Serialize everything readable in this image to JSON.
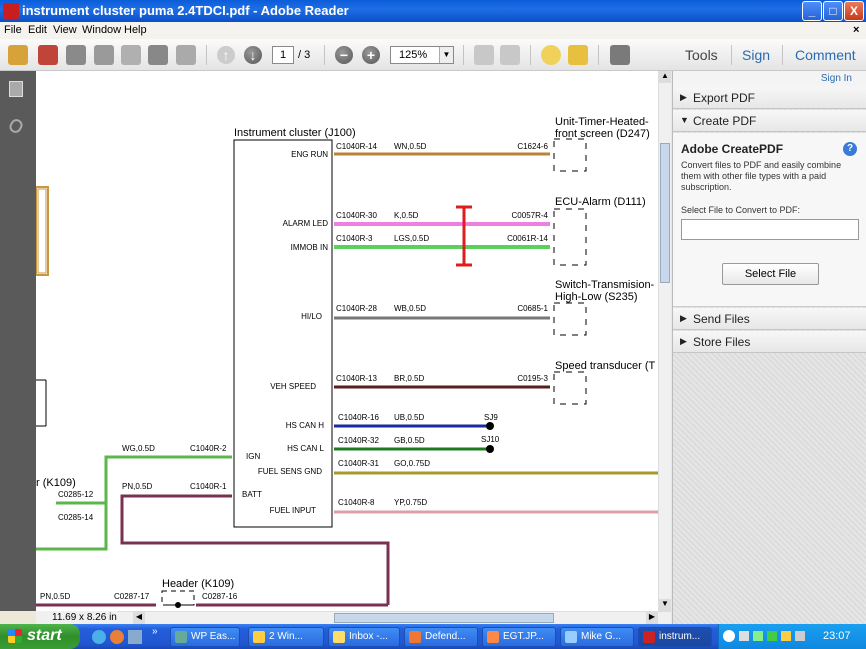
{
  "window": {
    "title": "instrument cluster puma 2.4TDCI.pdf - Adobe Reader",
    "min": "_",
    "max": "□",
    "close": "X"
  },
  "menu": [
    "File",
    "Edit",
    "View",
    "Window",
    "Help"
  ],
  "menu_close": "×",
  "toolbar": {
    "page_current": "1",
    "page_total": "/ 3",
    "zoom": "125%",
    "tools": "Tools",
    "sign": "Sign",
    "comment": "Comment"
  },
  "right_panel": {
    "sign_in": "Sign In",
    "export_pdf": "Export PDF",
    "create_pdf": "Create PDF",
    "createpdf_title": "Adobe CreatePDF",
    "createpdf_desc": "Convert files to PDF and easily combine them with other file types with a paid subscription.",
    "select_label": "Select File to Convert to PDF:",
    "select_button": "Select File",
    "send_files": "Send Files",
    "store_files": "Store Files"
  },
  "status": {
    "page_size": "11.69 x 8.26 in"
  },
  "diagram": {
    "cluster_title": "Instrument cluster (J100)",
    "pins": [
      "ENG RUN",
      "ALARM LED",
      "IMMOB IN",
      "HI/LO",
      "VEH SPEED",
      "HS CAN H",
      "HS CAN L",
      "FUEL SENS GND",
      "FUEL INPUT",
      "IGN",
      "BATT"
    ],
    "wires": [
      {
        "pin": "C1040R-14",
        "wire": "WN,0.5D",
        "dest": "C1624-6"
      },
      {
        "pin": "C1040R-30",
        "wire": "K,0.5D",
        "dest": "C0057R-4"
      },
      {
        "pin": "C1040R-3",
        "wire": "LGS,0.5D",
        "dest": "C0061R-14"
      },
      {
        "pin": "C1040R-28",
        "wire": "WB,0.5D",
        "dest": "C0685-1"
      },
      {
        "pin": "C1040R-13",
        "wire": "BR,0.5D",
        "dest": "C0195-3"
      },
      {
        "pin": "C1040R-16",
        "wire": "UB,0.5D",
        "dest": "SJ9"
      },
      {
        "pin": "C1040R-32",
        "wire": "GB,0.5D",
        "dest": "SJ10"
      },
      {
        "pin": "C1040R-31",
        "wire": "GO,0.75D",
        "dest": ""
      },
      {
        "pin": "C1040R-8",
        "wire": "YP,0.75D",
        "dest": ""
      }
    ],
    "left_wires": [
      {
        "wire": "WG,0.5D",
        "pin": "C1040R-2"
      },
      {
        "wire": "PN,0.5D",
        "pin": "C1040R-1"
      }
    ],
    "components": [
      "Unit-Timer-Heated-",
      "front screen (D247)",
      "ECU-Alarm (D111)",
      "Switch-Transmision-",
      "High-Low (S235)",
      "Speed transducer (T"
    ],
    "left_labels": [
      "r (K109)",
      "C0285-12",
      "C0285-14",
      "PN,0.5D",
      "C0287-17",
      "Header (K109)",
      "C0287-16"
    ]
  },
  "taskbar": {
    "start": "start",
    "tasks": [
      "WP Eas...",
      "2 Win...",
      "Inbox -...",
      "Defend...",
      "EGT.JP...",
      "Mike G...",
      "instrum..."
    ],
    "clock": "23:07"
  }
}
